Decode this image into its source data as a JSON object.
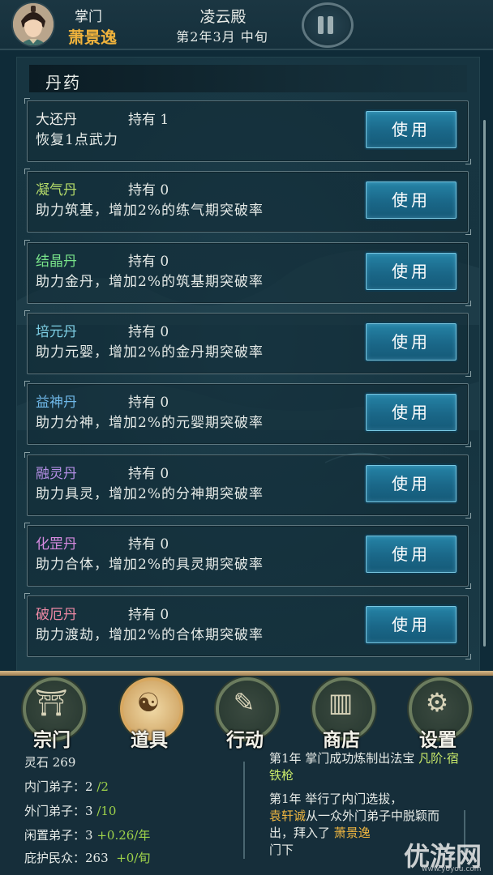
{
  "header": {
    "role_title": "掌门",
    "leader_name": "萧景逸",
    "hall_name": "凌云殿",
    "date": "第2年3月 中旬"
  },
  "section_title": "丹药",
  "pills": [
    {
      "name": "大还丹",
      "own": "持有 1",
      "desc": "恢复1点武力",
      "color": "#f2f2ee",
      "button": "使用"
    },
    {
      "name": "凝气丹",
      "own": "持有 0",
      "desc": "助力筑基，增加2%的练气期突破率",
      "color": "#b6dc6a",
      "button": "使用"
    },
    {
      "name": "结晶丹",
      "own": "持有 0",
      "desc": "助力金丹，增加2%的筑基期突破率",
      "color": "#79e48a",
      "button": "使用"
    },
    {
      "name": "培元丹",
      "own": "持有 0",
      "desc": "助力元婴，增加2%的金丹期突破率",
      "color": "#7fd0e6",
      "button": "使用"
    },
    {
      "name": "益神丹",
      "own": "持有 0",
      "desc": "助力分神，增加2%的元婴期突破率",
      "color": "#6fb8e8",
      "button": "使用"
    },
    {
      "name": "融灵丹",
      "own": "持有 0",
      "desc": "助力具灵，增加2%的分神期突破率",
      "color": "#b58fe6",
      "button": "使用"
    },
    {
      "name": "化罡丹",
      "own": "持有 0",
      "desc": "助力合体，增加2%的具灵期突破率",
      "color": "#d68ae0",
      "button": "使用"
    },
    {
      "name": "破厄丹",
      "own": "持有 0",
      "desc": "助力渡劫，增加2%的合体期突破率",
      "color": "#f08aa6",
      "button": "使用"
    }
  ],
  "nav": [
    {
      "label": "宗门",
      "icon": "sect-gate-icon",
      "glyph": "⛩"
    },
    {
      "label": "道具",
      "icon": "pouch-icon",
      "glyph": "☯"
    },
    {
      "label": "行动",
      "icon": "scroll-brush-icon",
      "glyph": "✎"
    },
    {
      "label": "商店",
      "icon": "shop-building-icon",
      "glyph": "▥"
    },
    {
      "label": "设置",
      "icon": "gear-icon",
      "glyph": "⚙"
    }
  ],
  "stats": {
    "spirit_stone": "灵石 269",
    "inner_label": "内门弟子：2",
    "inner_max": "/2",
    "outer_label": "外门弟子：3",
    "outer_max": "/10",
    "idle_label": "闲置弟子：3",
    "idle_rate": "+0.26/年",
    "people_label": "庇护民众：263",
    "people_rate": "+0/旬"
  },
  "log": {
    "e1_a": "第1年  掌门成功炼制出法宝 ",
    "e1_item": "凡阶·宿铁枪",
    "e2_a": "第1年  举行了内门选拔，",
    "e2_name": "袁轩诚",
    "e2_b": "从一众外门弟子中脱颖而出，拜入了 ",
    "e2_leader": "萧景逸",
    "e2_c": "门下"
  },
  "watermark": {
    "text": "优游网",
    "url": "www.yoyou.com"
  }
}
